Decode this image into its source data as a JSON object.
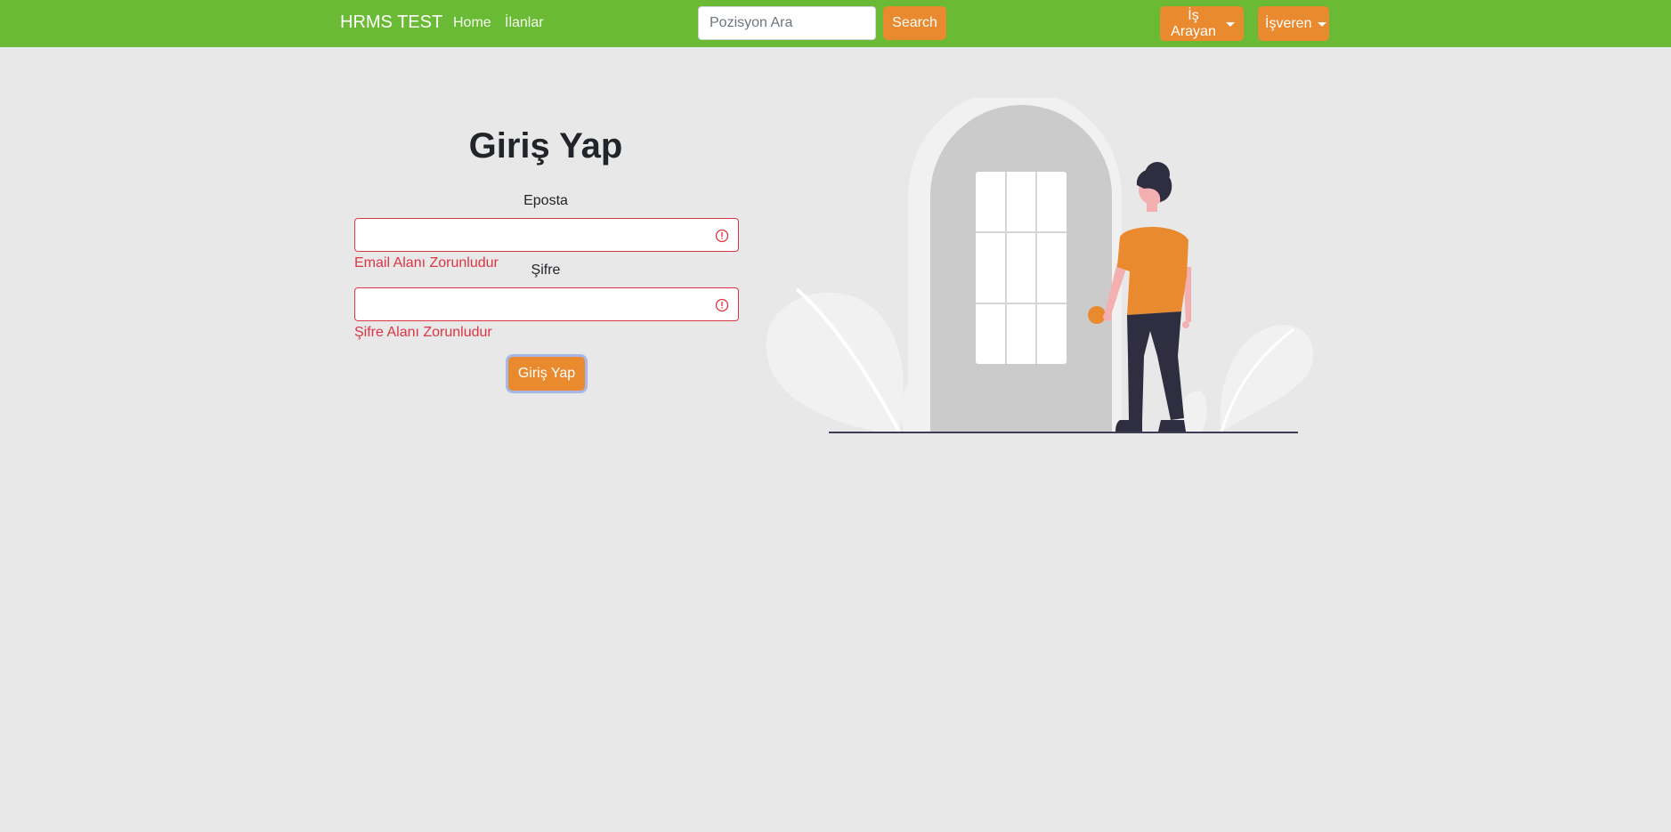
{
  "navbar": {
    "brand": "HRMS TEST",
    "links": [
      "Home",
      "İlanlar"
    ],
    "search": {
      "placeholder": "Pozisyon Ara",
      "value": "",
      "button_label": "Search"
    },
    "dropdowns": [
      "İş Arayan",
      "İşveren"
    ]
  },
  "login": {
    "title": "Giriş Yap",
    "email": {
      "label": "Eposta",
      "value": "",
      "error": "Email Alanı Zorunludur"
    },
    "password": {
      "label": "Şifre",
      "value": "",
      "error": "Şifre Alanı Zorunludur"
    },
    "submit_label": "Giriş Yap"
  },
  "colors": {
    "navbar": "#6aba35",
    "accent": "#e98a2f",
    "error": "#dc3545",
    "background": "#e8e8e8"
  },
  "icons": {
    "field_error": "exclamation-circle-icon",
    "dropdown": "caret-down-icon"
  }
}
